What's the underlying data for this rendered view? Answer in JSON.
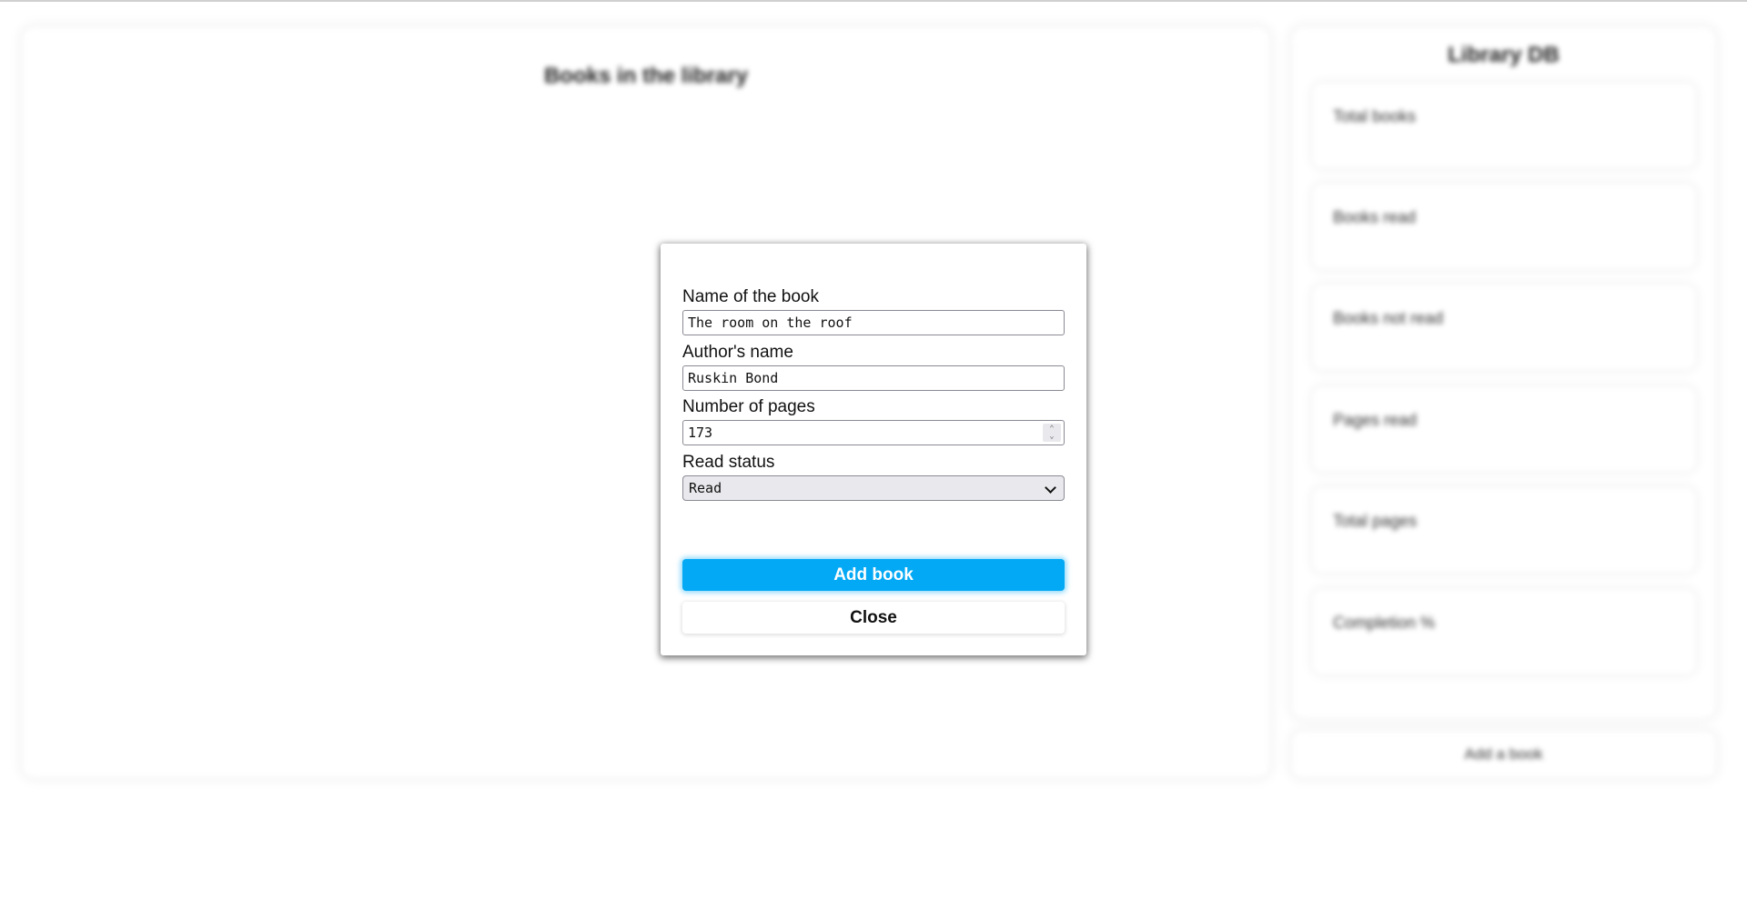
{
  "main": {
    "title": "Books in the library"
  },
  "sidebar": {
    "title": "Library DB",
    "stats": [
      {
        "label": "Total books"
      },
      {
        "label": "Books read"
      },
      {
        "label": "Books not read"
      },
      {
        "label": "Pages read"
      },
      {
        "label": "Total pages"
      },
      {
        "label": "Completion %"
      }
    ],
    "add_button_label": "Add a book"
  },
  "modal": {
    "fields": {
      "name": {
        "label": "Name of the book",
        "value": "The room on the roof"
      },
      "author": {
        "label": "Author's name",
        "value": "Ruskin Bond"
      },
      "pages": {
        "label": "Number of pages",
        "value": "173"
      },
      "status": {
        "label": "Read status",
        "value": "Read"
      }
    },
    "add_button_label": "Add book",
    "close_button_label": "Close"
  },
  "colors": {
    "accent": "#03a9f4"
  }
}
